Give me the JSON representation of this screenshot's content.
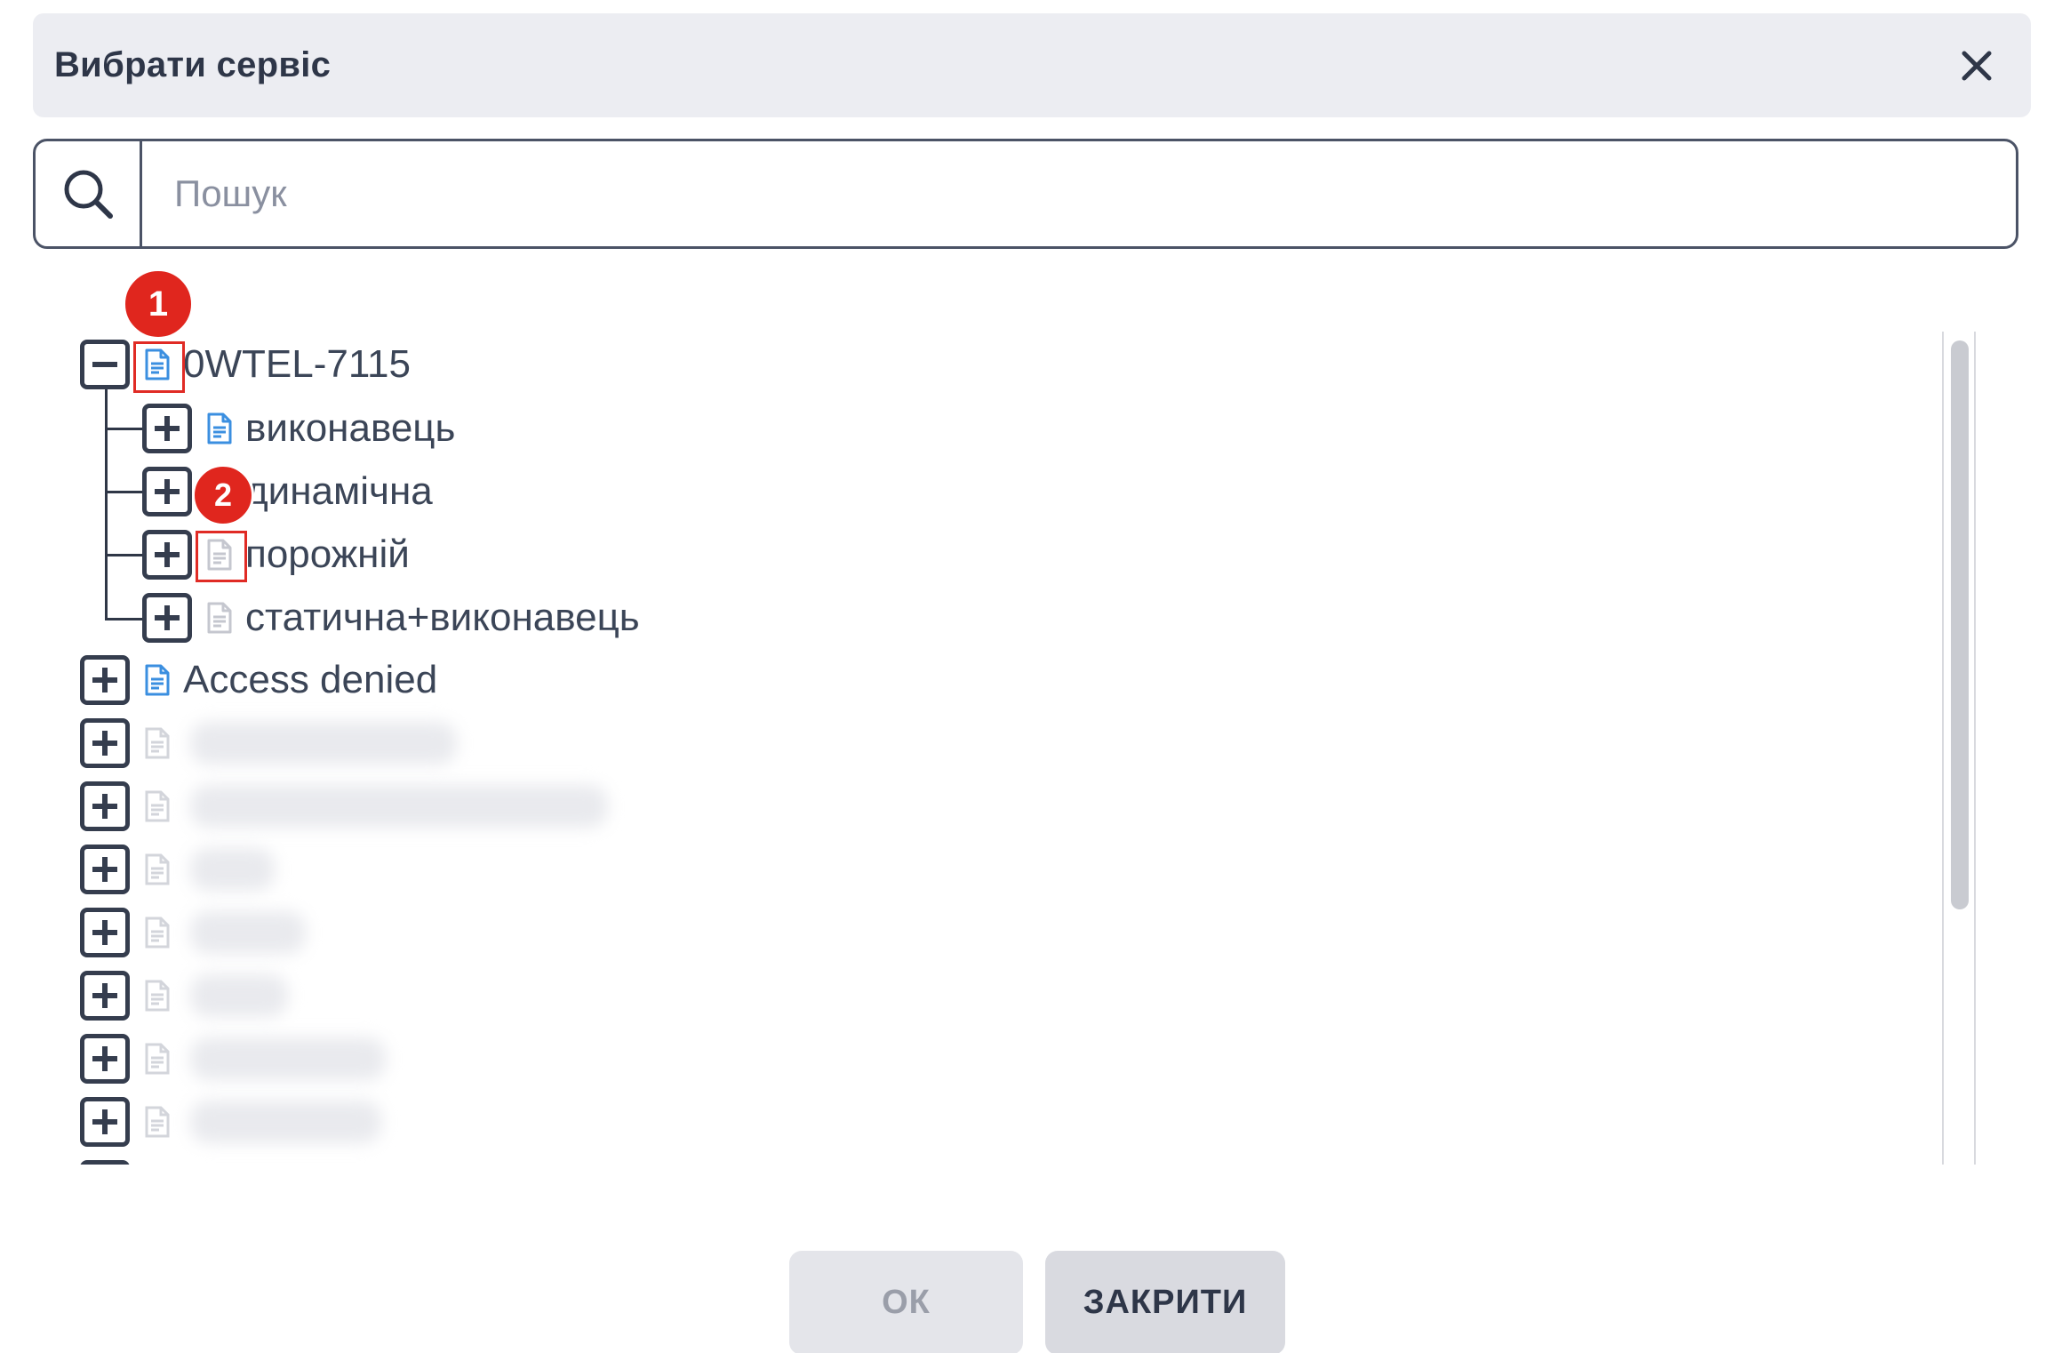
{
  "dialog": {
    "title": "Вибрати сервіс"
  },
  "search": {
    "placeholder": "Пошук"
  },
  "tree": {
    "root": {
      "label": "0WTEL-7115",
      "expanded": true,
      "icon": "document-icon",
      "icon_color": "#3b8fe0"
    },
    "children": [
      {
        "label": "виконавець",
        "icon": "document-icon",
        "icon_color": "#3b8fe0"
      },
      {
        "label": "динамічна",
        "icon": "document-icon",
        "icon_color": "#c5c7cf"
      },
      {
        "label": "порожній",
        "icon": "document-icon",
        "icon_color": "#c5c7cf"
      },
      {
        "label": "статична+виконавець",
        "icon": "document-icon",
        "icon_color": "#c5c7cf"
      }
    ],
    "access_denied": {
      "label": "Access denied",
      "icon": "document-icon",
      "icon_color": "#3b8fe0"
    },
    "blurred_items_count": 7
  },
  "annotations": [
    {
      "number": "1"
    },
    {
      "number": "2"
    }
  ],
  "buttons": {
    "ok": "ОК",
    "close": "ЗАКРИТИ"
  },
  "colors": {
    "accent_blue": "#3b8fe0",
    "muted_icon": "#c5c7cf",
    "annotation_red": "#e0261e"
  }
}
